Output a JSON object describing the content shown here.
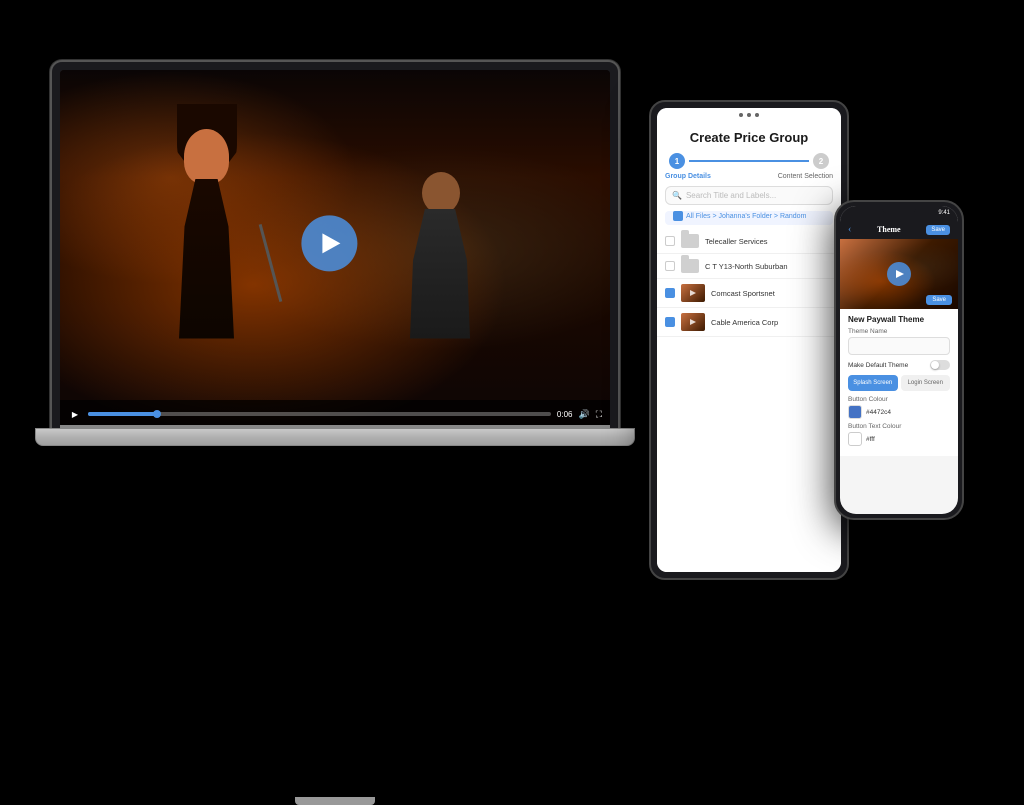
{
  "laptop": {
    "video": {
      "time": "0:06"
    }
  },
  "tablet": {
    "title": "Create Price Group",
    "steps": [
      {
        "label": "Group Details",
        "state": "active",
        "number": "1"
      },
      {
        "label": "Content Selection",
        "state": "inactive",
        "number": "2"
      }
    ],
    "search_placeholder": "Search Title and Labels...",
    "breadcrumb": "All Files > Johanna's Folder > Random",
    "files": [
      {
        "name": "Telecaller Services",
        "type": "folder",
        "checked": false
      },
      {
        "name": "C T Y13-North Suburban",
        "type": "folder",
        "checked": false
      },
      {
        "name": "Comcast Sportsnet",
        "type": "video",
        "checked": true
      },
      {
        "name": "Cable America Corp",
        "type": "video",
        "checked": true
      }
    ]
  },
  "phone": {
    "status": "Notch",
    "header": {
      "back_label": "‹",
      "title": "Theme",
      "action_label": "Save"
    },
    "section_title": "New Paywall Theme",
    "fields": [
      {
        "label": "Theme Name",
        "value": "",
        "type": "input"
      },
      {
        "label": "Make Default Theme",
        "value": "",
        "type": "toggle"
      },
      {
        "label": "Splash Screen",
        "tab": "active"
      },
      {
        "label": "Login Screen",
        "tab": "inactive"
      },
      {
        "label": "Button Colour",
        "value": ""
      },
      {
        "label": "Button Text Colour",
        "value": ""
      },
      {
        "label": "colour_value",
        "value": "#fff"
      }
    ],
    "button_color": "#4472c4",
    "button_text_color": "#fff",
    "tabs": [
      {
        "label": "Splash Screen",
        "active": true
      },
      {
        "label": "Login Screen",
        "active": false
      }
    ]
  }
}
